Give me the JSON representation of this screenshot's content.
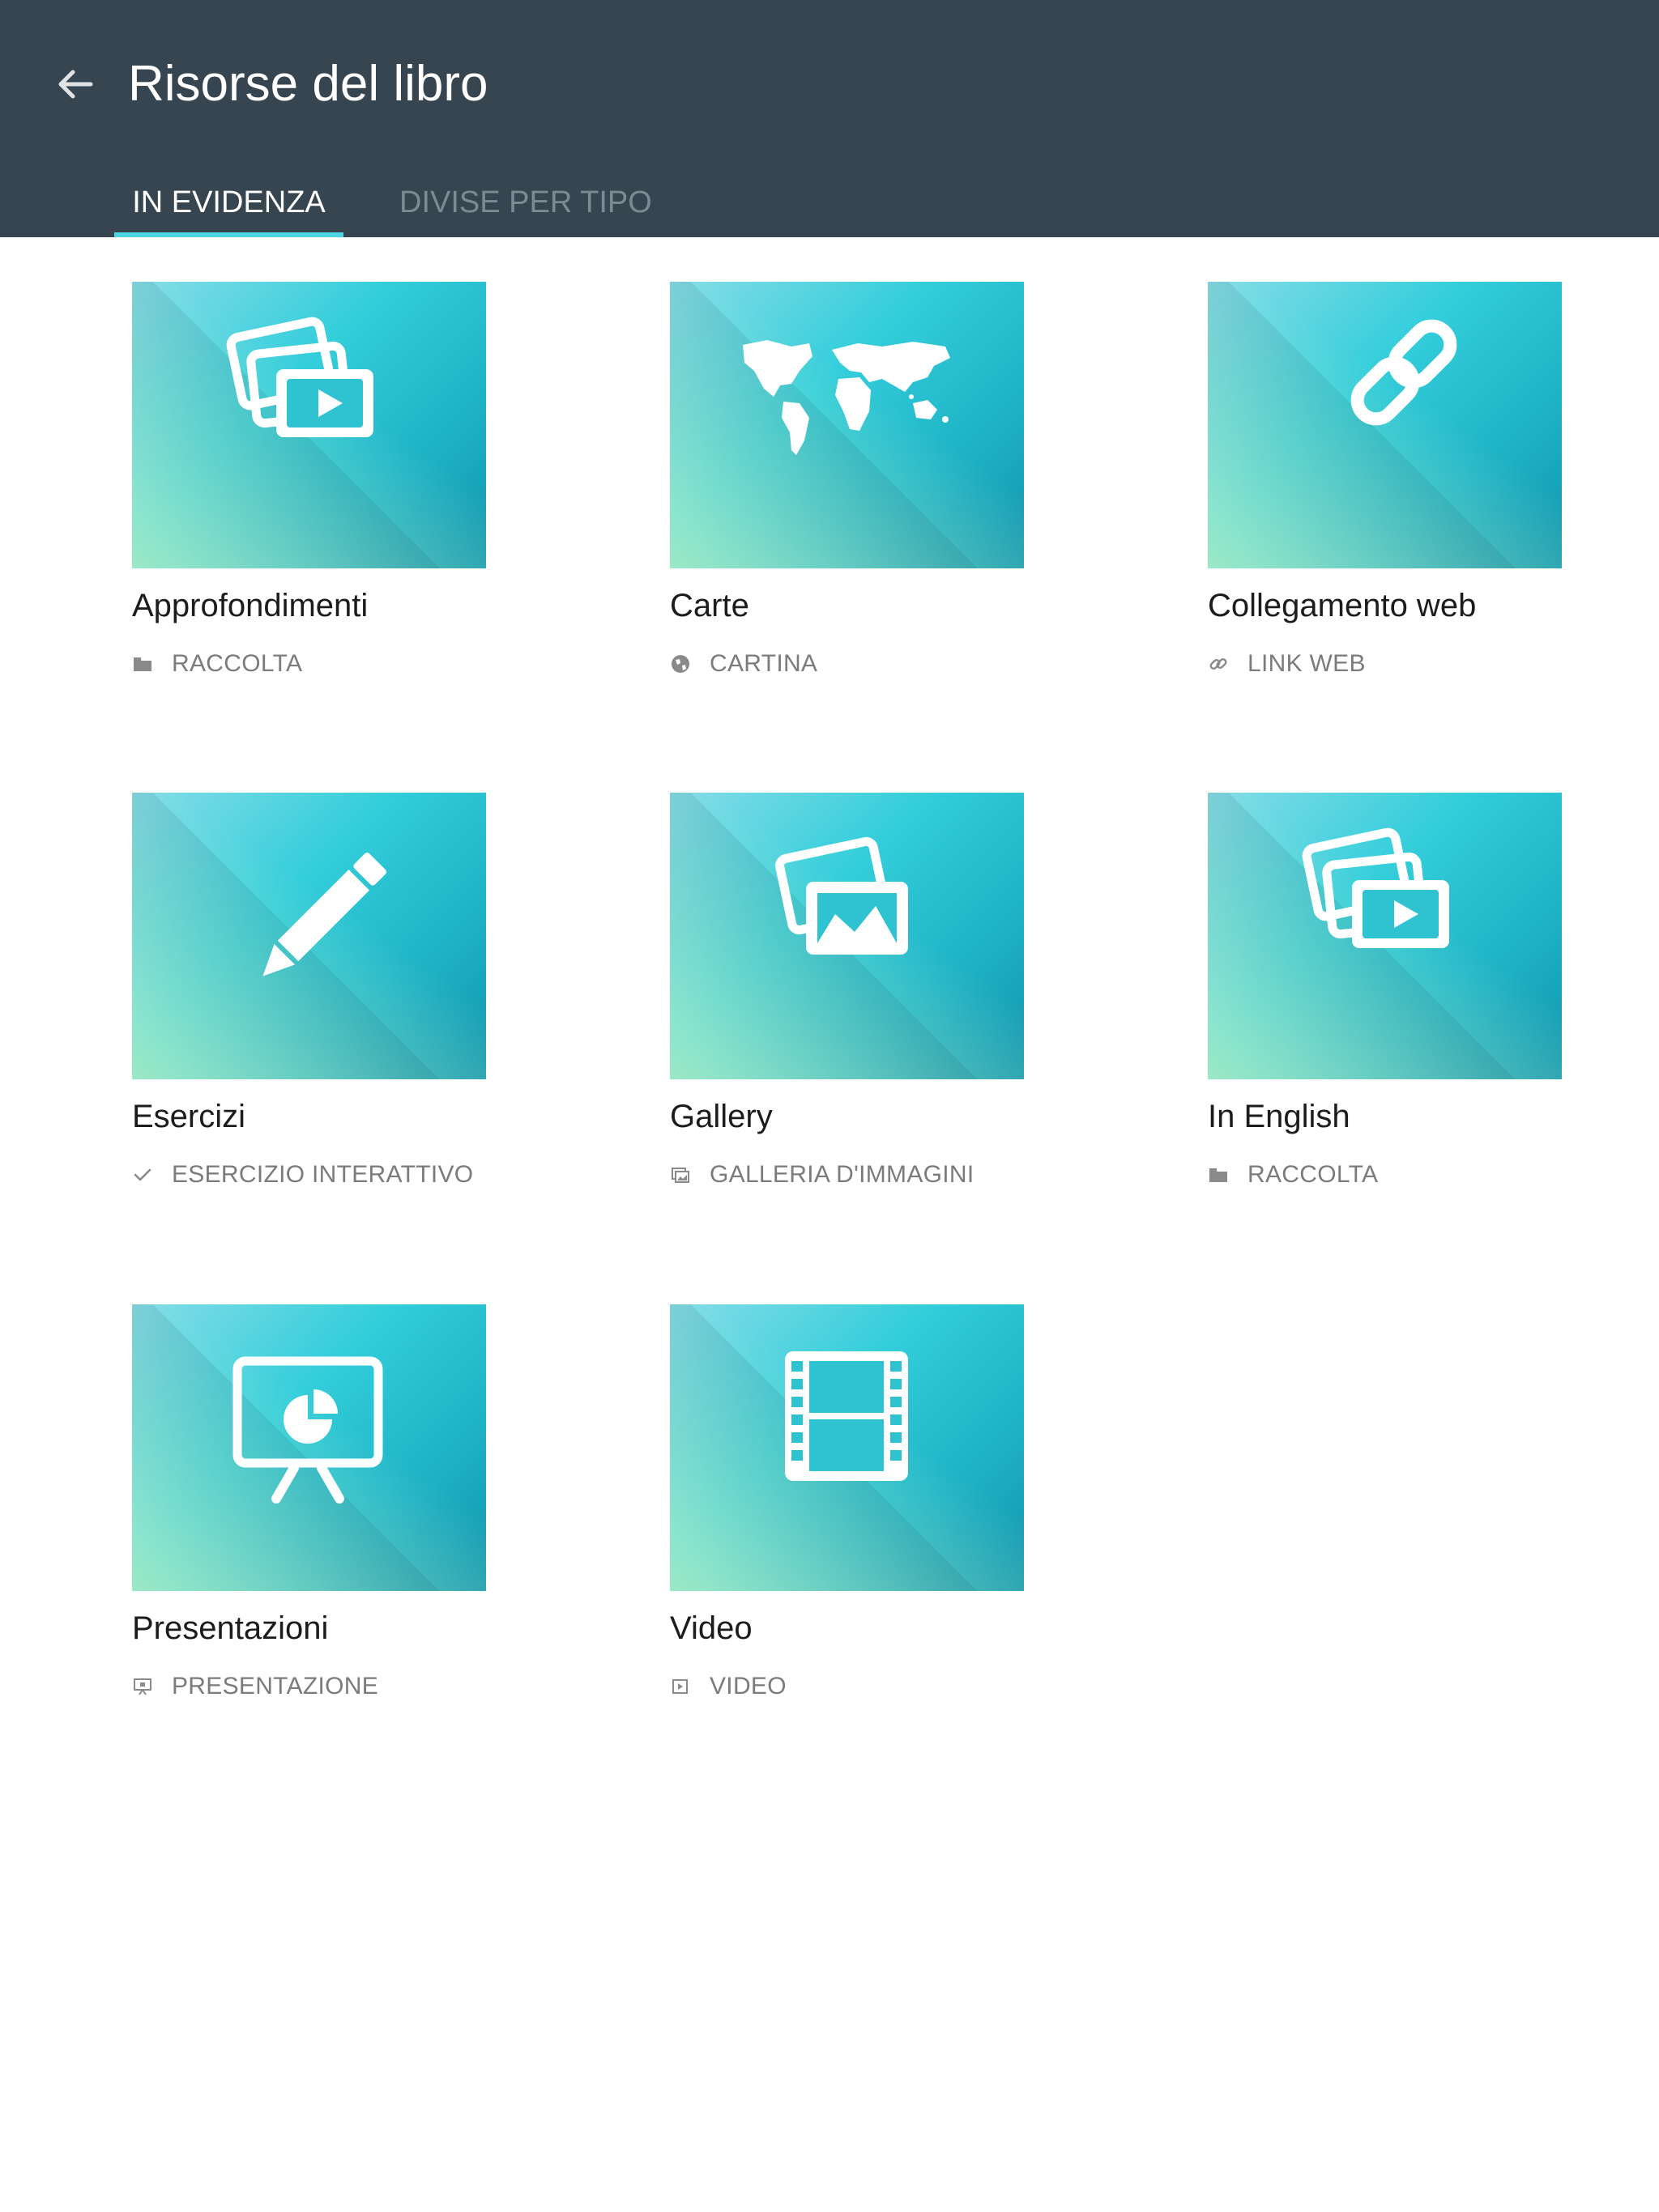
{
  "header": {
    "title": "Risorse del libro",
    "back_icon": "arrow-left-icon"
  },
  "tabs": [
    {
      "label": "IN EVIDENZA",
      "active": true
    },
    {
      "label": "DIVISE PER TIPO",
      "active": false
    }
  ],
  "colors": {
    "appbar": "#36454f",
    "tab_indicator": "#4fd6e4",
    "thumbnail_teal": "#1fb5c8"
  },
  "cards": [
    {
      "title": "Approfondimenti",
      "type": "RACCOLTA",
      "icon": "media-stack-icon",
      "type_icon": "folder-icon"
    },
    {
      "title": "Carte",
      "type": "CARTINA",
      "icon": "world-map-icon",
      "type_icon": "globe-icon"
    },
    {
      "title": "Collegamento web",
      "type": "LINK  WEB",
      "icon": "link-icon",
      "type_icon": "link-icon"
    },
    {
      "title": "Esercizi",
      "type": "ESERCIZIO INTERATTIVO",
      "icon": "pencil-icon",
      "type_icon": "checkmark-icon"
    },
    {
      "title": "Gallery",
      "type": "GALLERIA D'IMMAGINI",
      "icon": "image-gallery-icon",
      "type_icon": "gallery-icon"
    },
    {
      "title": "In English",
      "type": "RACCOLTA",
      "icon": "media-stack-icon",
      "type_icon": "folder-icon"
    },
    {
      "title": "Presentazioni",
      "type": "PRESENTAZIONE",
      "icon": "presentation-icon",
      "type_icon": "presentation-icon"
    },
    {
      "title": "Video",
      "type": "VIDEO",
      "icon": "film-strip-icon",
      "type_icon": "play-icon"
    }
  ]
}
